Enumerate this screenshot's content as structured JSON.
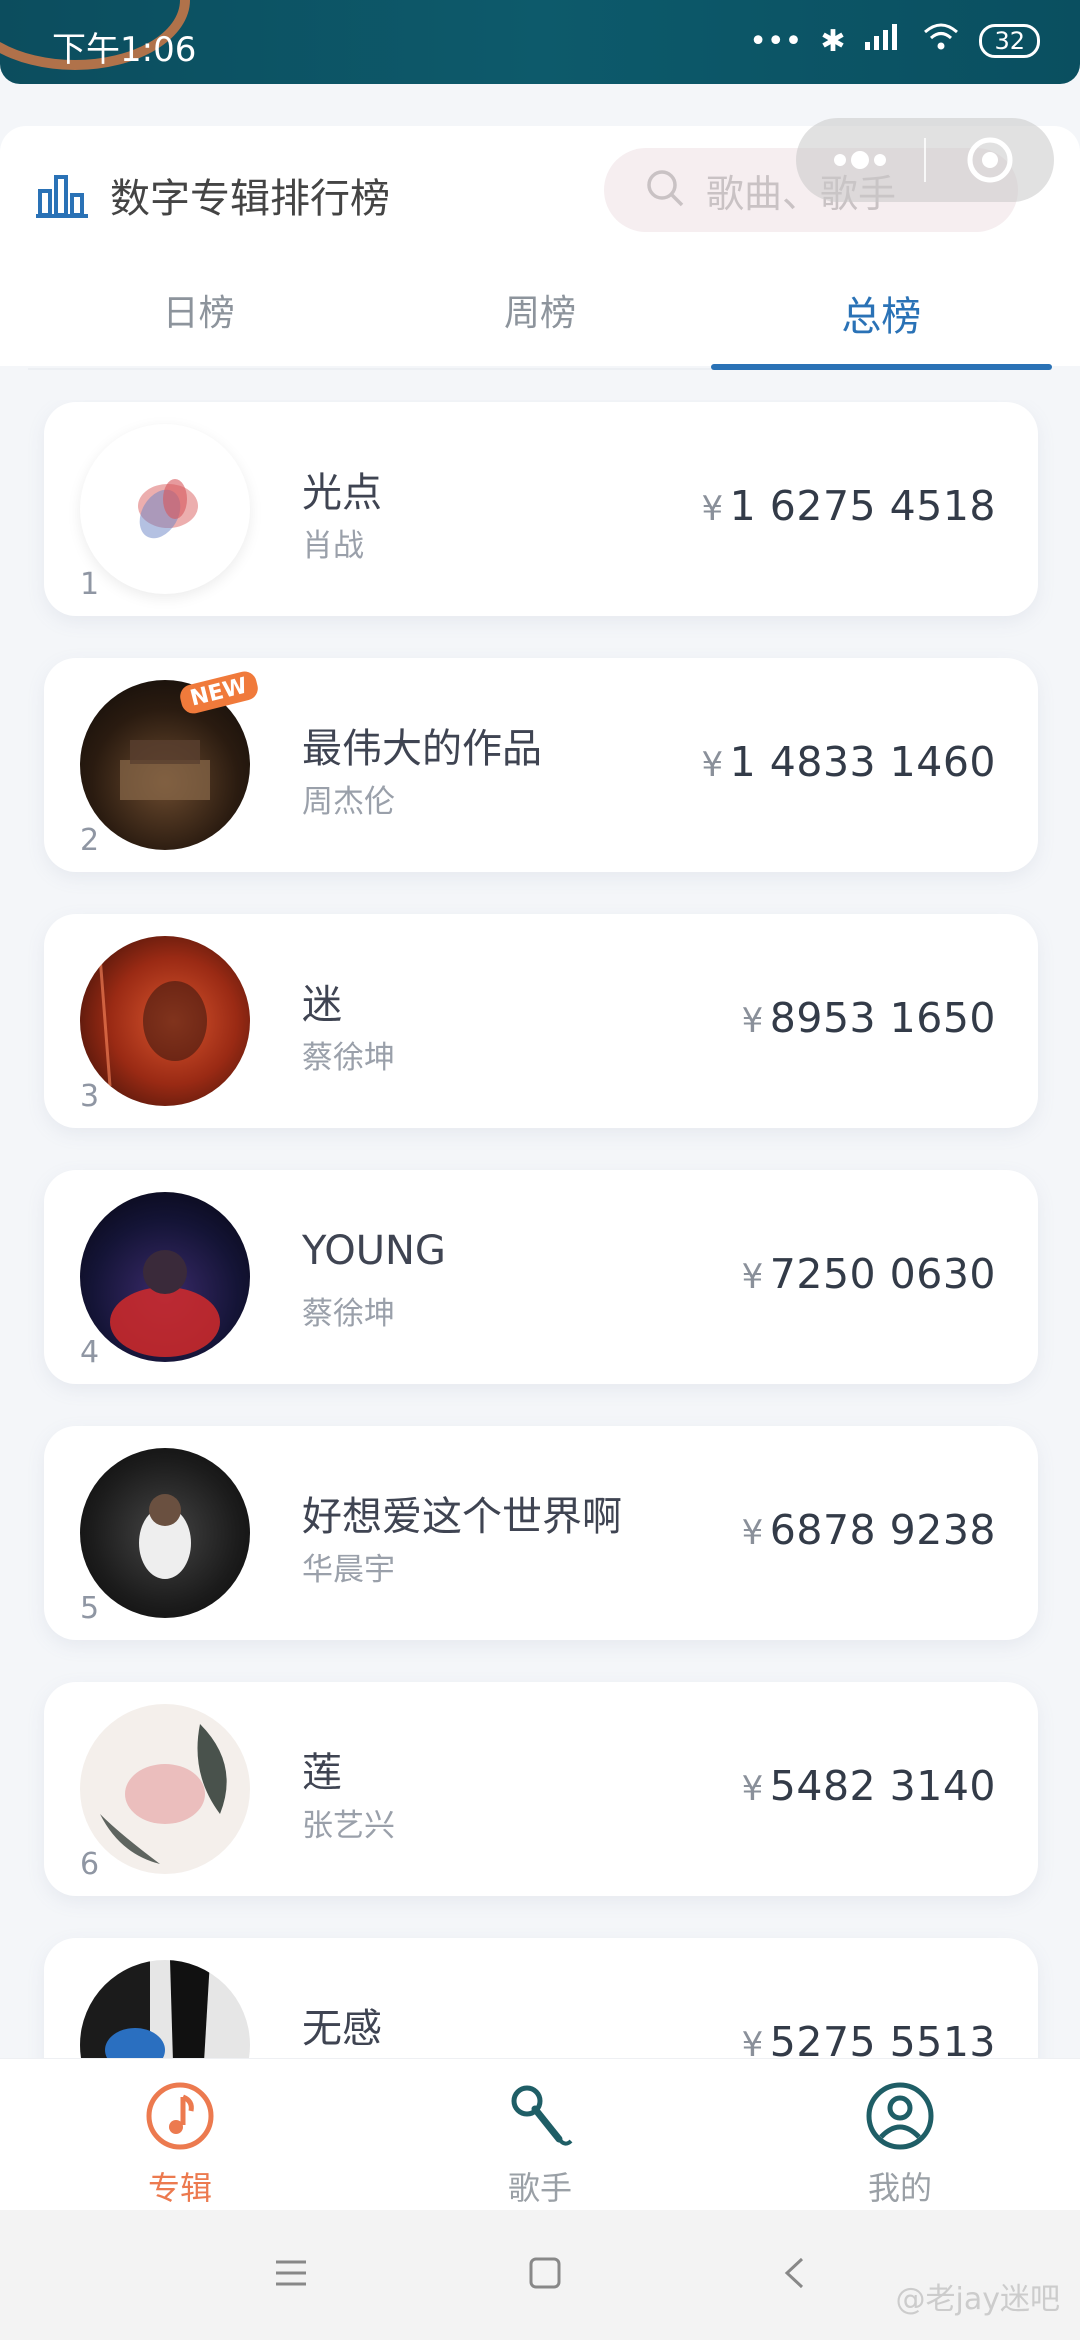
{
  "status_bar": {
    "time": "下午1:06",
    "battery": "32"
  },
  "header": {
    "title": "数字专辑排行榜",
    "search_placeholder": "歌曲、歌手"
  },
  "tabs": [
    {
      "label": "日榜",
      "active": false
    },
    {
      "label": "周榜",
      "active": false
    },
    {
      "label": "总榜",
      "active": true
    }
  ],
  "currency_symbol": "¥",
  "albums": [
    {
      "rank": "1",
      "name": "光点",
      "artist": "肖战",
      "amount": "1 6275 4518"
    },
    {
      "rank": "2",
      "name": "最伟大的作品",
      "artist": "周杰伦",
      "amount": "1 4833 1460",
      "badge": "NEW"
    },
    {
      "rank": "3",
      "name": "迷",
      "artist": "蔡徐坤",
      "amount": "8953 1650"
    },
    {
      "rank": "4",
      "name": "YOUNG",
      "artist": "蔡徐坤",
      "amount": "7250 0630"
    },
    {
      "rank": "5",
      "name": "好想爱这个世界啊",
      "artist": "华晨宇",
      "amount": "6878 9238"
    },
    {
      "rank": "6",
      "name": "莲",
      "artist": "张艺兴",
      "amount": "5482 3140"
    },
    {
      "rank": "",
      "name": "无感",
      "artist": "",
      "amount": "5275 5513"
    }
  ],
  "bottom_tabs": [
    {
      "label": "专辑",
      "icon": "music-note-icon",
      "active": true
    },
    {
      "label": "歌手",
      "icon": "microphone-icon",
      "active": false
    },
    {
      "label": "我的",
      "icon": "user-icon",
      "active": false
    }
  ],
  "watermark": "@老jay迷吧",
  "colors": {
    "accent_blue": "#2a72b6",
    "accent_orange": "#ec7a4f",
    "status_bar": "#0d5a6b"
  }
}
